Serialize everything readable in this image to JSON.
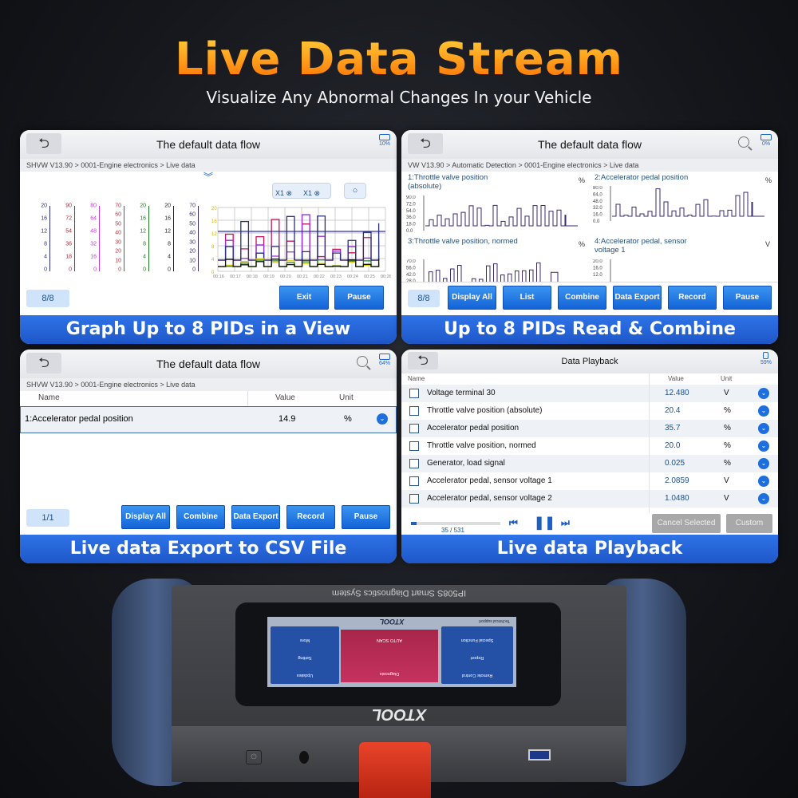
{
  "headline": "Live Data Stream",
  "subheadline": "Visualize Any Abnormal Changes In your Vehicle",
  "colors": {
    "accent_blue": "#1e63d8",
    "headline_orange": "#ff8a10",
    "device_grip": "#3b4f6e",
    "connector": "#e0351f"
  },
  "panel_graph": {
    "title": "The default data flow",
    "battery": "10%",
    "breadcrumb": "SHVW V13.90 > 0001-Engine electronics > Live data",
    "zoom_x": "X1",
    "zoom_y": "X1",
    "axes": [
      {
        "color": "#2a2f7a",
        "ticks": [
          "20",
          "16",
          "12",
          "8",
          "4",
          "0"
        ]
      },
      {
        "color": "#b0283c",
        "ticks": [
          "90",
          "72",
          "54",
          "36",
          "18",
          "0"
        ]
      },
      {
        "color": "#c23bd6",
        "ticks": [
          "80",
          "64",
          "48",
          "32",
          "16",
          "0"
        ]
      },
      {
        "color": "#c0303a",
        "ticks": [
          "70",
          "60",
          "50",
          "40",
          "30",
          "20",
          "10",
          "0"
        ]
      },
      {
        "color": "#1f7a22",
        "ticks": [
          "20",
          "16",
          "12",
          "8",
          "4",
          "0"
        ]
      },
      {
        "color": "#222222",
        "ticks": [
          "20",
          "16",
          "12",
          "8",
          "4",
          "0"
        ]
      },
      {
        "color": "#3a2a6a",
        "ticks": [
          "70",
          "60",
          "50",
          "40",
          "30",
          "20",
          "10",
          "0"
        ]
      }
    ],
    "graph_y_ticks": [
      "20",
      "16",
      "12",
      "8",
      "4",
      "0"
    ],
    "time_ticks": [
      "00:16",
      "00:17",
      "00:18",
      "00:19",
      "00:20",
      "00:21",
      "00:22",
      "00:23",
      "00:24",
      "00:25",
      "00:26"
    ],
    "page": "8/8",
    "buttons": [
      "Exit",
      "Pause"
    ],
    "banner": "Graph Up to 8 PIDs in a View"
  },
  "panel_combine": {
    "title": "The default data flow",
    "battery": "0%",
    "breadcrumb": "VW V13.90 > Automatic Detection  > 0001-Engine electronics > Live data",
    "pids": [
      {
        "name": "1:Throttle valve position (absolute)",
        "unit": "%",
        "ticks": [
          "90.0",
          "72.0",
          "54.0",
          "36.0",
          "18.0",
          "0.0"
        ]
      },
      {
        "name": "2:Accelerator pedal position",
        "unit": "%",
        "ticks": [
          "80.0",
          "64.0",
          "48.0",
          "32.0",
          "16.0",
          "0.0"
        ]
      },
      {
        "name": "3:Throttle valve position, normed",
        "unit": "%",
        "ticks": [
          "70.0",
          "56.0",
          "42.0",
          "28.0"
        ]
      },
      {
        "name": "4:Accelerator pedal, sensor voltage 1",
        "unit": "V",
        "ticks": [
          "20.0",
          "16.0",
          "12.0"
        ]
      }
    ],
    "page": "8/8",
    "buttons": [
      "Display All",
      "List",
      "Combine",
      "Data Export",
      "Record",
      "Pause"
    ],
    "banner": "Up to 8 PIDs Read & Combine"
  },
  "panel_export": {
    "title": "The default data flow",
    "battery": "64%",
    "breadcrumb": "SHVW V13.90 > 0001-Engine electronics > Live data",
    "columns": [
      "Name",
      "Value",
      "Unit"
    ],
    "rows": [
      {
        "name": "1:Accelerator pedal position",
        "value": "14.9",
        "unit": "%"
      }
    ],
    "page": "1/1",
    "buttons": [
      "Display All",
      "Combine",
      "Data Export",
      "Record",
      "Pause"
    ],
    "banner": "Live data Export to CSV File"
  },
  "panel_playback": {
    "title": "Data Playback",
    "battery": "59%",
    "columns": [
      "Name",
      "Value",
      "Unit"
    ],
    "rows": [
      {
        "name": "Voltage terminal 30",
        "value": "12.480",
        "unit": "V"
      },
      {
        "name": "Throttle valve position (absolute)",
        "value": "20.4",
        "unit": "%"
      },
      {
        "name": "Accelerator pedal position",
        "value": "35.7",
        "unit": "%"
      },
      {
        "name": "Throttle valve position, normed",
        "value": "20.0",
        "unit": "%"
      },
      {
        "name": "Generator, load signal",
        "value": "0.025",
        "unit": "%"
      },
      {
        "name": "Accelerator pedal, sensor voltage 1",
        "value": "2.0859",
        "unit": "V"
      },
      {
        "name": "Accelerator pedal, sensor voltage 2",
        "value": "1.0480",
        "unit": "V"
      }
    ],
    "frame": "35 / 531",
    "progress_fraction": 0.066,
    "buttons": [
      "Cancel Selected",
      "Custom"
    ],
    "banner": "Live data Playback"
  },
  "device": {
    "model_label": "IP508S Smart Diagnostics System",
    "brand": "XTOOL",
    "screen_tiles": {
      "left": [
        "More",
        "Setting",
        "Updates"
      ],
      "center": [
        "Diagnosis",
        "AUTO SCAN"
      ],
      "right": [
        "Remote Control",
        "Report",
        "Special Function"
      ]
    },
    "footer": "Technical support"
  }
}
